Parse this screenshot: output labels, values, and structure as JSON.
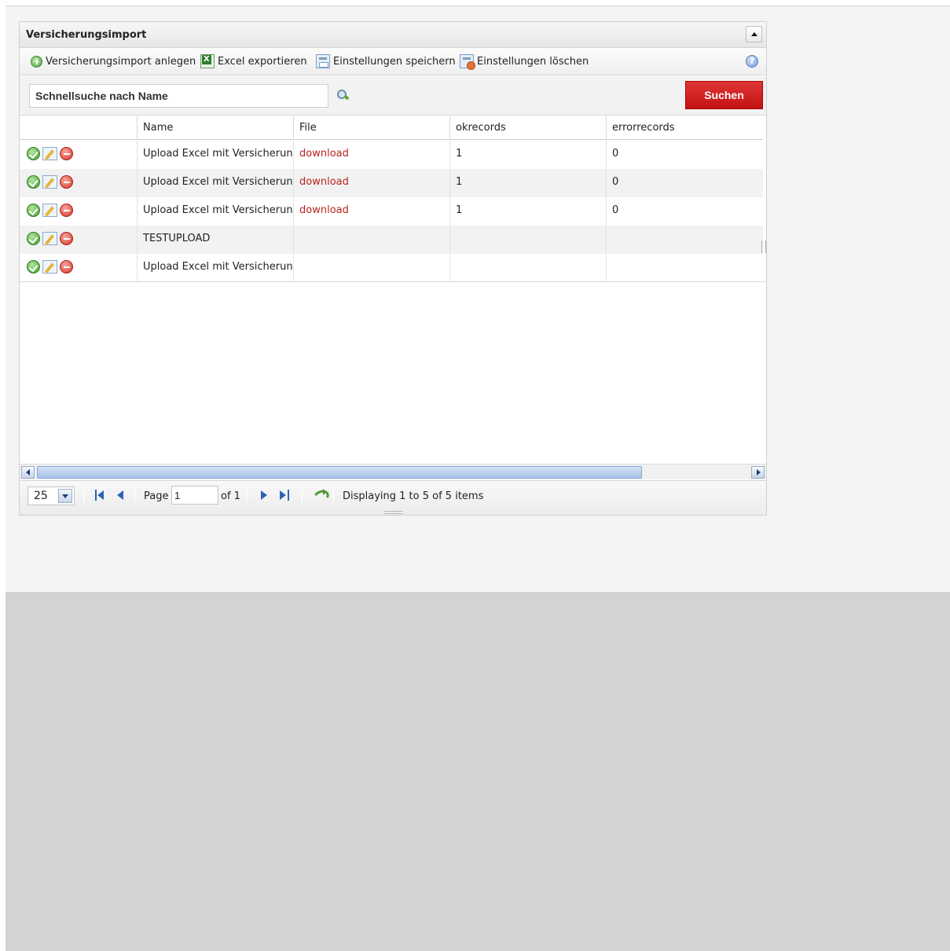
{
  "panel": {
    "title": "Versicherungsimport"
  },
  "toolbar": {
    "add_label": "Versicherungsimport anlegen",
    "excel_label": "Excel exportieren",
    "save_settings_label": "Einstellungen speichern",
    "delete_settings_label": "Einstellungen löschen",
    "icons": [
      "add-icon",
      "excel-icon",
      "save-settings-icon",
      "delete-settings-icon",
      "help-icon"
    ]
  },
  "search": {
    "placeholder": "Schnellsuche nach Name",
    "value": "",
    "button_label": "Suchen",
    "button_color": "#d42020"
  },
  "grid": {
    "columns": [
      "",
      "Name",
      "File",
      "okrecords",
      "errorrecords"
    ],
    "rows": [
      {
        "name": "Upload Excel mit Versicherungsdaten",
        "file": "download",
        "okrecords": "1",
        "errorrecords": "0"
      },
      {
        "name": "Upload Excel mit Versicherungsdaten",
        "file": "download",
        "okrecords": "1",
        "errorrecords": "0"
      },
      {
        "name": "Upload Excel mit Versicherungsdaten",
        "file": "download",
        "okrecords": "1",
        "errorrecords": "0"
      },
      {
        "name": "TESTUPLOAD",
        "file": "",
        "okrecords": "",
        "errorrecords": ""
      },
      {
        "name": "Upload Excel mit Versicherungsdaten",
        "file": "",
        "okrecords": "",
        "errorrecords": ""
      }
    ],
    "row_action_icons": [
      "approve-icon",
      "edit-icon",
      "remove-icon"
    ],
    "link_color": "#b7231f"
  },
  "pager": {
    "page_size": "25",
    "page_label": "Page",
    "page_value": "1",
    "of_label": "of 1",
    "displaying": "Displaying 1 to 5 of 5 items"
  }
}
